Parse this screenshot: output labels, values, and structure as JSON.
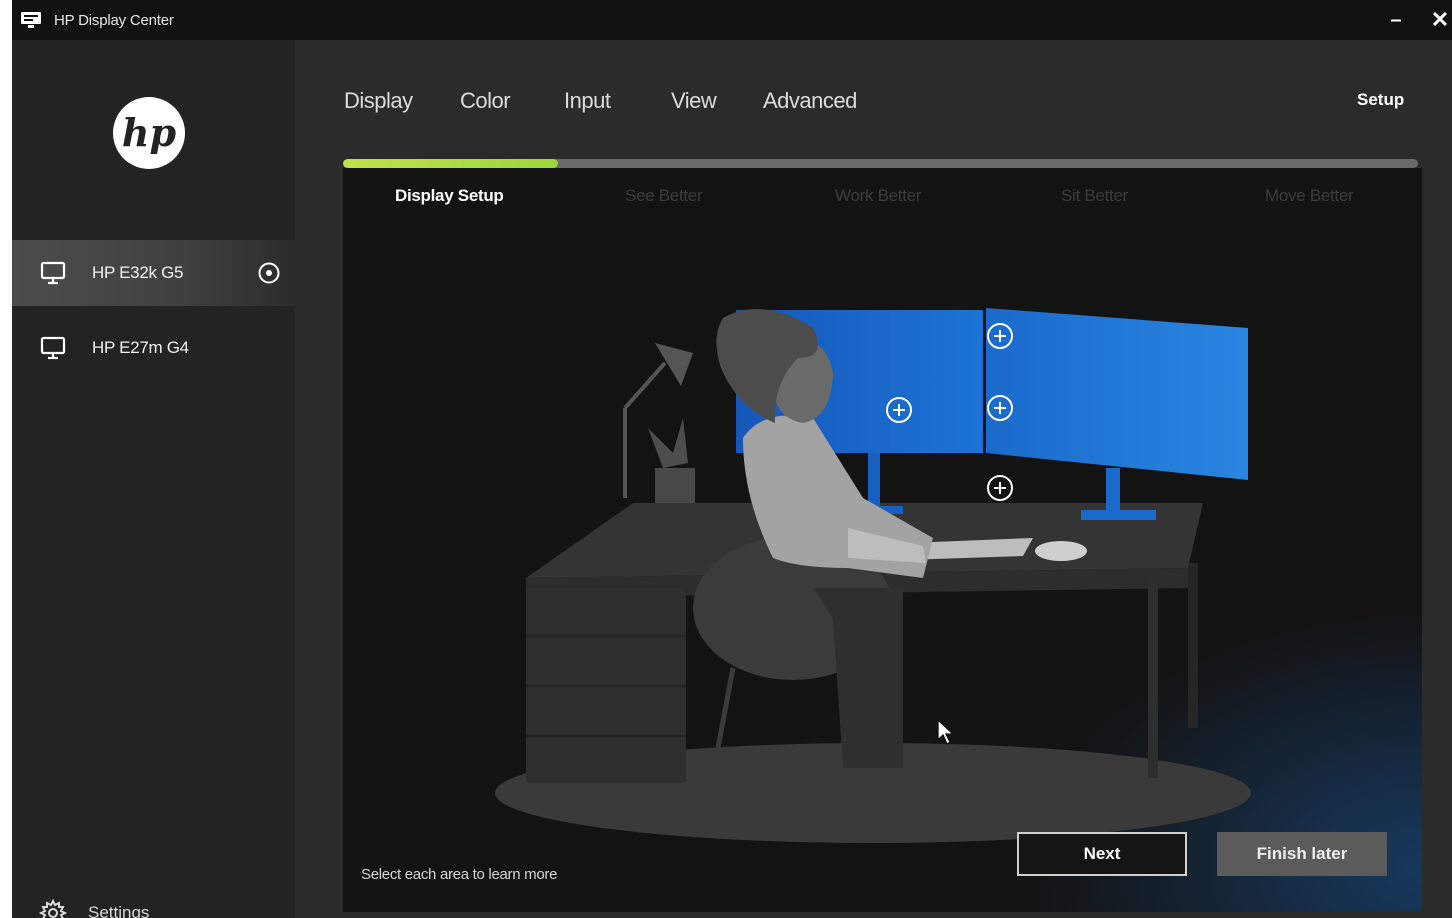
{
  "window": {
    "title": "HP Display Center",
    "minimize_label": "–",
    "close_label": "✕"
  },
  "sidebar": {
    "monitors": [
      {
        "label": "HP E32k G5",
        "active": true
      },
      {
        "label": "HP E27m G4",
        "active": false
      }
    ],
    "settings_label": "Settings"
  },
  "nav": {
    "tabs": [
      "Display",
      "Color",
      "Input",
      "View",
      "Advanced"
    ],
    "setup_label": "Setup"
  },
  "setup": {
    "progress": 0.2,
    "steps": [
      "Display Setup",
      "See Better",
      "Work Better",
      "Sit Better",
      "Move Better"
    ],
    "active_step": 0,
    "hint": "Select each area to learn more",
    "next_label": "Next",
    "finish_label": "Finish later"
  },
  "colors": {
    "accent": "#a8d840",
    "monitor_blue": "#1a73d6",
    "panel_bg": "#131313"
  }
}
